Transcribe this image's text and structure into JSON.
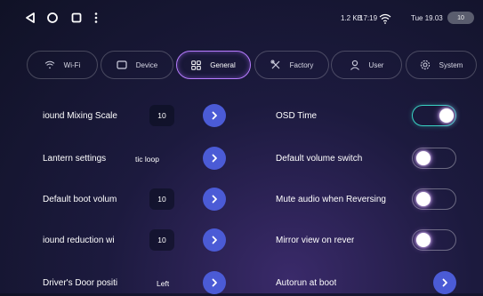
{
  "status": {
    "net_speed": "1.2 KB",
    "time": "17:19",
    "date": "Tue 19.03",
    "battery": "10"
  },
  "tabs": [
    {
      "label": "Wi-Fi",
      "icon": "wifi-icon",
      "active": false
    },
    {
      "label": "Device",
      "icon": "device-icon",
      "active": false
    },
    {
      "label": "General",
      "icon": "grid-icon",
      "active": true
    },
    {
      "label": "Factory",
      "icon": "tools-icon",
      "active": false
    },
    {
      "label": "User",
      "icon": "user-icon",
      "active": false
    },
    {
      "label": "System",
      "icon": "gear-icon",
      "active": false
    }
  ],
  "left_settings": [
    {
      "label": "iound Mixing Scale",
      "value": "10"
    },
    {
      "label": "Lantern settings",
      "value": "tic loop"
    },
    {
      "label": "Default boot volum",
      "value": "10"
    },
    {
      "label": "iound reduction wi",
      "value": "10"
    },
    {
      "label": "Driver's Door positi",
      "value": "Left"
    }
  ],
  "right_settings": [
    {
      "label": "OSD Time",
      "state": "on"
    },
    {
      "label": "Default volume switch",
      "state": "off"
    },
    {
      "label": "Mute audio when Reversing",
      "state": "off"
    },
    {
      "label": "Mirror view on rever",
      "state": "off"
    },
    {
      "label": "Autorun at boot",
      "state": "arrow"
    }
  ],
  "colors": {
    "accent": "#b77cff",
    "toggle_on": "#39d3c4",
    "arrow_button": "#4b5bd6"
  }
}
